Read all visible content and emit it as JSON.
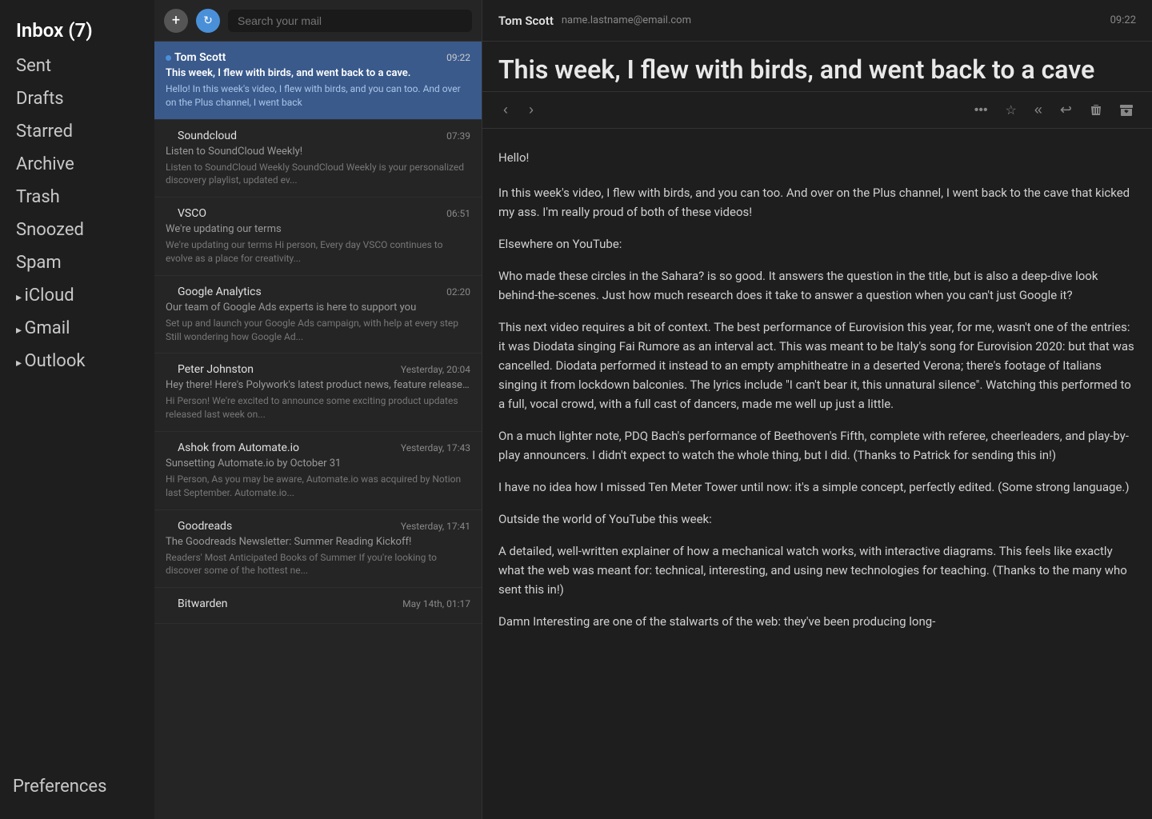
{
  "sidebar": {
    "inbox_label": "Inbox (7)",
    "items": [
      {
        "id": "sent",
        "label": "Sent"
      },
      {
        "id": "drafts",
        "label": "Drafts"
      },
      {
        "id": "starred",
        "label": "Starred"
      },
      {
        "id": "archive",
        "label": "Archive"
      },
      {
        "id": "trash",
        "label": "Trash"
      },
      {
        "id": "snoozed",
        "label": "Snoozed"
      },
      {
        "id": "spam",
        "label": "Spam"
      },
      {
        "id": "icloud",
        "label": "iCloud",
        "hasArrow": true
      },
      {
        "id": "gmail",
        "label": "Gmail",
        "hasArrow": true
      },
      {
        "id": "outlook",
        "label": "Outlook",
        "hasArrow": true
      }
    ],
    "preferences_label": "Preferences"
  },
  "search": {
    "placeholder": "Search your mail"
  },
  "emails": [
    {
      "id": 1,
      "sender": "Tom Scott",
      "time": "09:22",
      "subject": "This week, I flew with birds, and went back to a cave.",
      "preview": "Hello! In this week's video, I flew with birds, and you can too. And over on the Plus channel, I went back",
      "unread": true,
      "selected": true
    },
    {
      "id": 2,
      "sender": "Soundcloud",
      "time": "07:39",
      "subject": "Listen to SoundCloud Weekly!",
      "preview": "Listen to SoundCloud Weekly SoundCloud Weekly is your personalized discovery playlist, updated ev...",
      "unread": false,
      "selected": false
    },
    {
      "id": 3,
      "sender": "VSCO",
      "time": "06:51",
      "subject": "We're updating our terms",
      "preview": "We're updating our terms Hi person, Every day VSCO continues to evolve as a place for creativity...",
      "unread": false,
      "selected": false
    },
    {
      "id": 4,
      "sender": "Google Analytics",
      "time": "02:20",
      "subject": "Our team of Google Ads experts is here to support you",
      "preview": "Set up and launch your Google Ads campaign, with help at every step Still wondering how Google Ad...",
      "unread": false,
      "selected": false
    },
    {
      "id": 5,
      "sender": "Peter Johnston",
      "time": "Yesterday, 20:04",
      "subject": "Hey there! Here's Polywork's latest product news, feature releases and new opportunities!",
      "preview": "Hi Person! We're excited to announce some exciting product updates released last week on...",
      "unread": false,
      "selected": false
    },
    {
      "id": 6,
      "sender": "Ashok from Automate.io",
      "time": "Yesterday, 17:43",
      "subject": "Sunsetting Automate.io by October 31",
      "preview": "Hi Person, As you may be aware, Automate.io was acquired by Notion last September. Automate.io...",
      "unread": false,
      "selected": false
    },
    {
      "id": 7,
      "sender": "Goodreads",
      "time": "Yesterday, 17:41",
      "subject": "The Goodreads Newsletter: Summer Reading Kickoff!",
      "preview": "Readers' Most Anticipated Books of Summer If you're looking to discover some of the hottest ne...",
      "unread": false,
      "selected": false
    },
    {
      "id": 8,
      "sender": "Bitwarden",
      "time": "May 14th, 01:17",
      "subject": "",
      "preview": "",
      "unread": false,
      "selected": false
    }
  ],
  "detail": {
    "from_name": "Tom Scott",
    "from_email": "name.lastname@email.com",
    "time": "09:22",
    "subject": "This week, I flew with birds, and went back to a cave",
    "greeting": "Hello!",
    "body_paragraphs": [
      "In this week's video, I flew with birds, and you can too. And over on the Plus channel, I went back to the cave that kicked my ass. I'm really proud of both of these videos!",
      "Elsewhere on YouTube:",
      "    Who made these circles in the Sahara? is so good. It answers the question in the title, but is also a deep-dive look behind-the-scenes. Just how much research does it take to answer a question when you can't just Google it?",
      "    This next video requires a bit of context. The best performance of Eurovision this year, for me, wasn't one of the entries: it was Diodata singing Fai Rumore as an interval act. This was meant to be Italy's song for Eurovision 2020: but that was cancelled. Diodata performed it instead to an empty amphitheatre in a deserted Verona; there's footage of Italians singing it from lockdown balconies. The lyrics include \"I can't bear it, this unnatural silence\". Watching this performed to a full, vocal crowd, with a full cast of dancers, made me well up just a little.",
      "    On a much lighter note, PDQ Bach's performance of Beethoven's Fifth, complete with referee, cheerleaders, and play-by-play announcers. I didn't expect to watch the whole thing, but I did. (Thanks to Patrick for sending this in!)",
      "    I have no idea how I missed Ten Meter Tower until now: it's a simple concept, perfectly edited. (Some strong language.)",
      "Outside the world of YouTube this week:",
      "    A detailed, well-written explainer of how a mechanical watch works, with interactive diagrams. This feels like exactly what the web was meant for: technical, interesting, and using new technologies for teaching. (Thanks to the many who sent this in!)",
      "Damn Interesting are one of the stalwarts of the web: they've been producing long-"
    ]
  },
  "toolbar": {
    "more_label": "•••",
    "star_label": "☆",
    "replyall_label": "«",
    "reply_label": "↩",
    "delete_label": "🗑",
    "archive_label": "📥"
  }
}
